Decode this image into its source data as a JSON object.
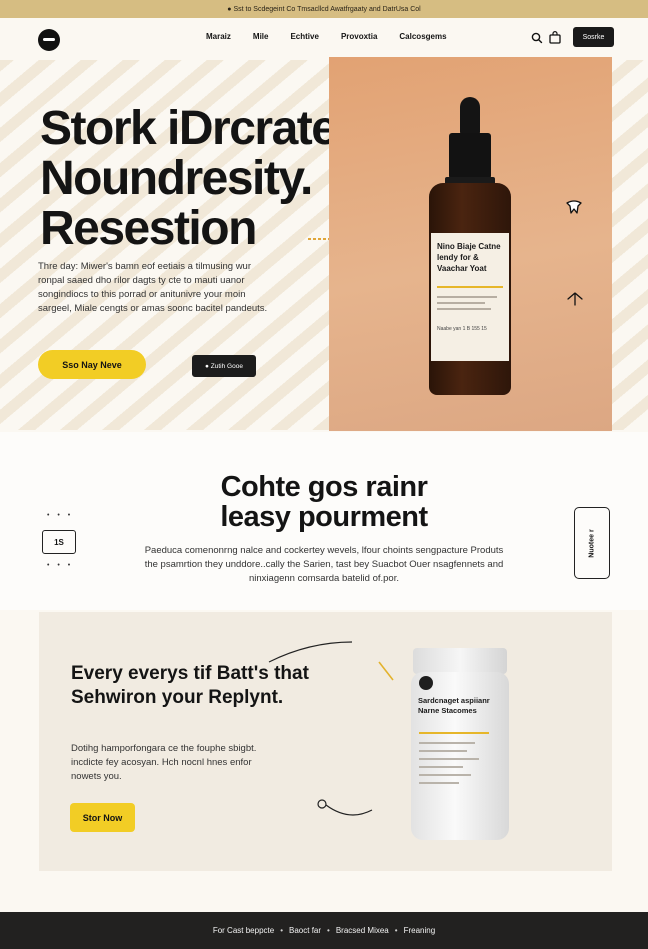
{
  "announcement": "● Sst to Scdegeint Co Tmsacllcd Awatfrgaaty and DatrUsa Col",
  "nav": {
    "links": [
      "Maraiz",
      "Mile",
      "Echtive",
      "Provoxtia",
      "Calcosgems"
    ],
    "button_label": "Sosrke"
  },
  "hero": {
    "title_lines": [
      "Stork iDrcrate",
      "Noundresity.",
      "Resestion"
    ],
    "description": "Thre day: Miwer's bamn eof eetiais a tilmusing wur ronpal saaed dho rilor dagts ty cte to mauti uanor songindiocs to this porrad or anitunivre your moin sargeel, Miale cengts or amas soonc bacitel pandeuts.",
    "primary_cta": "Sso Nay Neve",
    "secondary_cta": "● Zutih Gooe"
  },
  "product_bottle": {
    "label_title": "Nino Biaje Catne lendy for & Vaachar Yoat",
    "label_footer": "Naabe yan 1 B 155 15"
  },
  "features": {
    "title_lines": [
      "Cohte gos rainr",
      "leasy pourment"
    ],
    "description": "Paeduca comenonrng nalce and cockertey wevels, lfour choints sengpacture Produts the psamrtion they unddore..cally the Sarien, tast bey Suacbot Ouer nsagfennets and ninxiagenn comsarda batelid of.por.",
    "stat_dots_top": "• • •",
    "stat_label": "1S",
    "stat_dots_bottom": "• • •",
    "side_tag": "Nuotee r"
  },
  "promo": {
    "title": "Every everys tif Batt's that Sehwiron your Replynt.",
    "description": "Dotihg hamporfongara ce the fouphe sbigbt. incdicte fey acosyan. Hch nocnl hnes enfor nowets you.",
    "button": "Stor Now",
    "jar_title": "Sardcnaget aspiianr Narne Stacomes"
  },
  "footer": {
    "links": [
      "For Cast beppcte",
      "Baoct far",
      "Bracsed Mixea",
      "Freaning"
    ],
    "separator": "•"
  }
}
